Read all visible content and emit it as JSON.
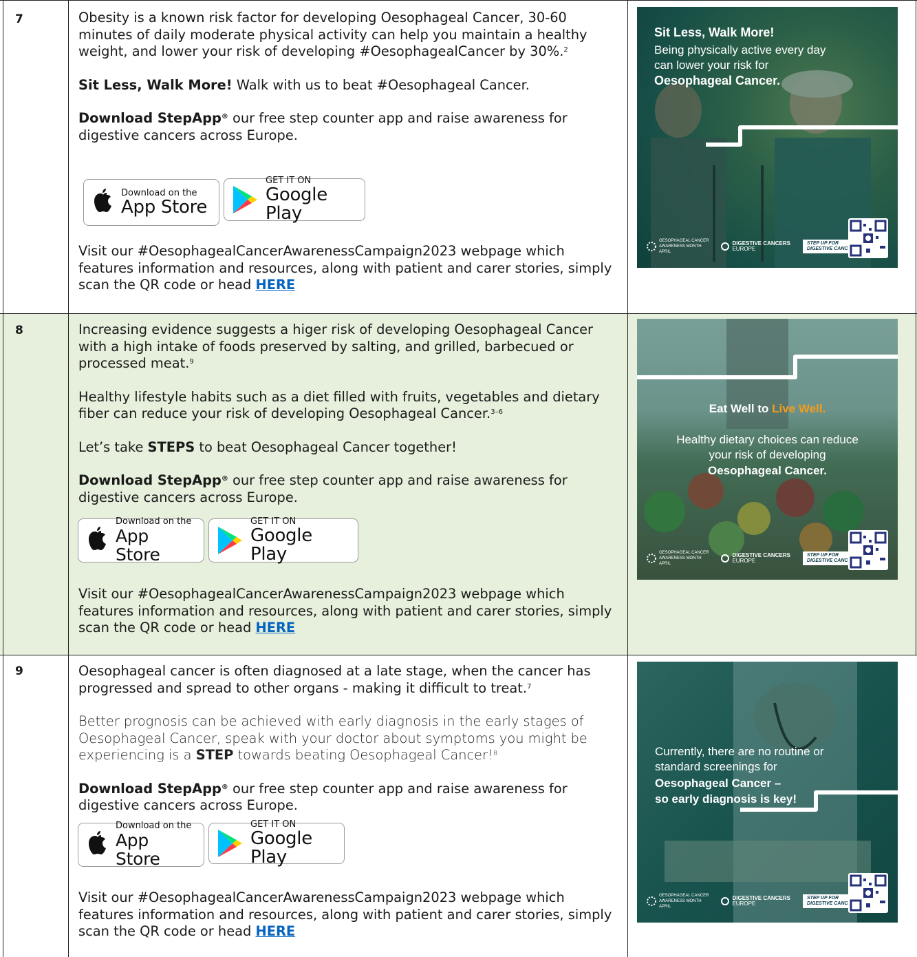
{
  "rows": [
    {
      "number": "7",
      "p1": "Obesity is a known risk factor for developing Oesophageal Cancer, 30-60 minutes of daily moderate physical activity can help you maintain a healthy weight, and lower your risk of developing #OesophagealCancer by 30%.",
      "p1_ref": "2",
      "p2_bold": "Sit Less, Walk More!",
      "p2_rest": " Walk with us to beat #Oesophageal Cancer.",
      "dl_bold": "Download StepApp",
      "dl_reg": "®",
      "dl_rest": " our free step counter app and raise awareness for digestive cancers across Europe.",
      "visit": "Visit our #OesophagealCancerAwarenessCampaign2023 webpage which features information and resources, along with patient and carer stories, simply scan the QR code or head ",
      "link": "HERE",
      "poster": {
        "line1": "Sit Less, Walk More!",
        "line2": "Being physically active every day can lower your risk for",
        "line3": "Oesophageal Cancer."
      }
    },
    {
      "number": "8",
      "p1": "Increasing evidence suggests a higer risk of developing Oesophageal Cancer with a high intake of foods preserved by salting, and grilled, barbecued or processed meat.",
      "p1_ref": "9",
      "p2": "Healthy lifestyle habits such as a diet filled with fruits, vegetables and dietary fiber can reduce your risk of developing Oesophageal Cancer.",
      "p2_ref": "3–6",
      "p3_a": "Let’s take ",
      "p3_bold": "STEPS",
      "p3_b": " to beat Oesophageal Cancer together!",
      "dl_bold": "Download StepApp",
      "dl_reg": "®",
      "dl_rest": " our free step counter app and raise awareness for digestive cancers across Europe.",
      "visit": "Visit our #OesophagealCancerAwarenessCampaign2023 webpage which features information and resources, along with patient and carer stories, simply scan the QR code or head ",
      "link": "HERE",
      "poster": {
        "line1a": "Eat Well to ",
        "line1b": "Live Well.",
        "line2": "Healthy dietary choices can reduce your risk of developing",
        "line3": "Oesophageal Cancer."
      }
    },
    {
      "number": "9",
      "p1": "Oesophageal cancer is often diagnosed at a late stage, when the cancer has progressed and spread to other organs - making it difficult to treat.",
      "p1_ref": "7",
      "p2_a": "Better prognosis can be achieved with early diagnosis in the early stages of Oesophageal Cancer, speak with your doctor about symptoms you might be experiencing is a ",
      "p2_bold": "STEP",
      "p2_b": " towards beating Oesophageal Cancer!",
      "p2_ref": "8",
      "dl_bold": "Download StepApp",
      "dl_reg": "®",
      "dl_rest": " our free step counter app and raise awareness for digestive cancers across Europe.",
      "visit": "Visit our #OesophagealCancerAwarenessCampaign2023 webpage which features information and resources, along with patient and carer stories, simply scan the QR code or head ",
      "link": "HERE",
      "poster": {
        "line1": "Currently, there are no routine or standard screenings for",
        "line2": "Oesophageal Cancer –",
        "line3": "so early diagnosis is key!"
      }
    }
  ],
  "badges": {
    "appstore_small": "Download on the",
    "appstore_big": "App Store",
    "google_small": "GET IT ON",
    "google_big": "Google Play"
  },
  "poster_footer": {
    "month_line1": "OESOPHAGEAL CANCER",
    "month_line2": "AWARENESS MONTH",
    "month_line3": "APRIL",
    "dce_line1": "DIGESTIVE CANCERS",
    "dce_line2": "EUROPE",
    "step_line1": "STEP UP FOR",
    "step_line2": "DIGESTIVE CANCERS"
  },
  "colors": {
    "row_highlight": "#e6f0dc",
    "link": "#0563c1",
    "poster_orange": "#f59c1a",
    "poster_overlay": "#0f5a55"
  }
}
